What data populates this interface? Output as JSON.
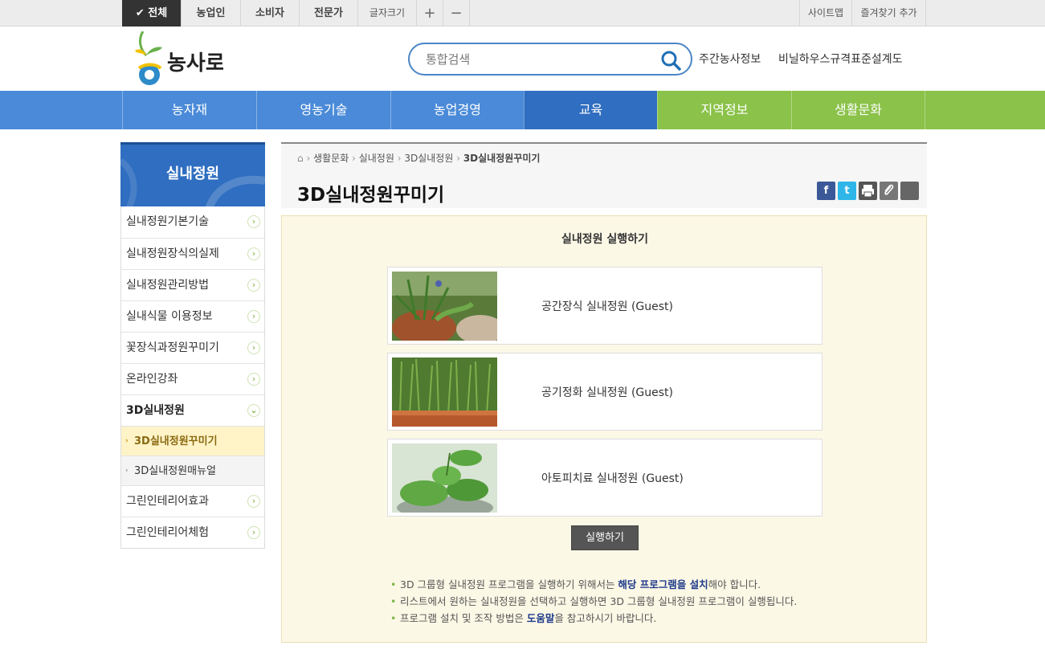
{
  "topbar": {
    "all_label": "전체",
    "farmer": "농업인",
    "consumer": "소비자",
    "expert": "전문가",
    "font_size": "글자크기",
    "plus": "+",
    "minus": "−",
    "sitemap": "사이트맵",
    "bookmark": "즐겨찾기 추가"
  },
  "header": {
    "logo_text": "농사로",
    "search_placeholder": "통합검색",
    "link_weekly": "주간농사정보",
    "link_greenhouse": "비닐하우스규격표준설계도"
  },
  "gnb": [
    "농자재",
    "영농기술",
    "농업경영",
    "교육",
    "지역정보",
    "생활문화"
  ],
  "lnb": {
    "title": "실내정원",
    "items": [
      "실내정원기본기술",
      "실내정원장식의실제",
      "실내정원관리방법",
      "실내식물 이용정보",
      "꽃장식과정원꾸미기",
      "온라인강좌",
      "3D실내정원"
    ],
    "subitems": [
      "3D실내정원꾸미기",
      "3D실내정원매뉴얼"
    ],
    "items_after": [
      "그린인테리어효과",
      "그린인테리어체험"
    ]
  },
  "breadcrumb": [
    "생활문화",
    "실내정원",
    "3D실내정원",
    "3D실내정원꾸미기"
  ],
  "page_title": "3D실내정원꾸미기",
  "share_icons": [
    "facebook-icon",
    "twitter-icon",
    "print-icon",
    "attach-icon",
    "more-icon"
  ],
  "content": {
    "title": "실내정원 실행하기",
    "gardens": [
      "공간장식 실내정원 (Guest)",
      "공기정화 실내정원 (Guest)",
      "아토피치료 실내정원 (Guest)"
    ],
    "run_button": "실행하기",
    "note1_pre": "3D 그룹형 실내정원 프로그램을 실행하기 위해서는 ",
    "note1_bold": "해당 프로그램을 설치",
    "note1_post": "해야 합니다.",
    "note2": "리스트에서 원하는 실내정원을 선택하고 실행하면 3D 그룹형 실내정원 프로그램이 실행됩니다.",
    "note3_pre": "프로그램 설치 및 조작 방법은 ",
    "note3_bold": "도움말",
    "note3_post": "을 참고하시기 바랍니다."
  },
  "colors": {
    "gnb_blue": "#4a8ad8",
    "gnb_active": "#2f6ec0",
    "gnb_green": "#8bc24a",
    "content_bg": "#fcf8e6"
  }
}
